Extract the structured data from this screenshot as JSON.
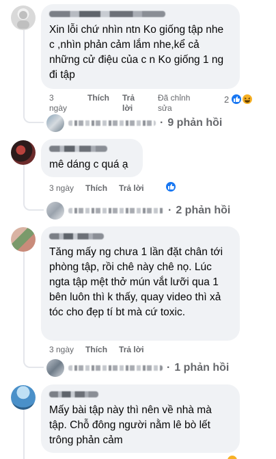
{
  "comments": [
    {
      "text": "Xin lỗi chứ nhìn ntn Ko giống tập nhe c ,nhìn phản cảm lắm nhe,kể cả những cử điệu của c n Ko giống 1 ng đi tập",
      "time": "3 ngày",
      "like": "Thích",
      "reply": "Trả lời",
      "edited": "Đã chỉnh sửa",
      "reaction_count": "2",
      "reactions": [
        "like-icon",
        "haha-icon"
      ],
      "replies_label": "9 phản hồi"
    },
    {
      "text": "mê dáng c quá ạ",
      "time": "3 ngày",
      "like": "Thích",
      "reply": "Trả lời",
      "reactions": [
        "like-icon"
      ],
      "replies_label": "2 phản hồi"
    },
    {
      "text": "Tăng mấy ng chưa 1 lần đặt chân tới phòng tập, rồi chê này chê nọ. Lúc ngta tập mệt thở mún vắt lưỡi qua 1 bên luôn thì k thấy, quay video thì xả tóc cho đẹp tí bt mà cứ toxic.",
      "time": "3 ngày",
      "like": "Thích",
      "reply": "Trả lời",
      "replies_label": "1 phản hồi"
    },
    {
      "text": "Mấy bài tập này thì nên về nhà mà tập. Chỗ đông người nằm lê bò lết trông phản cảm"
    }
  ],
  "colors": {
    "bubble": "#f0f2f5",
    "meta": "#65676b",
    "like_blue": "#1877f2",
    "haha_yellow": "#f7b125"
  }
}
